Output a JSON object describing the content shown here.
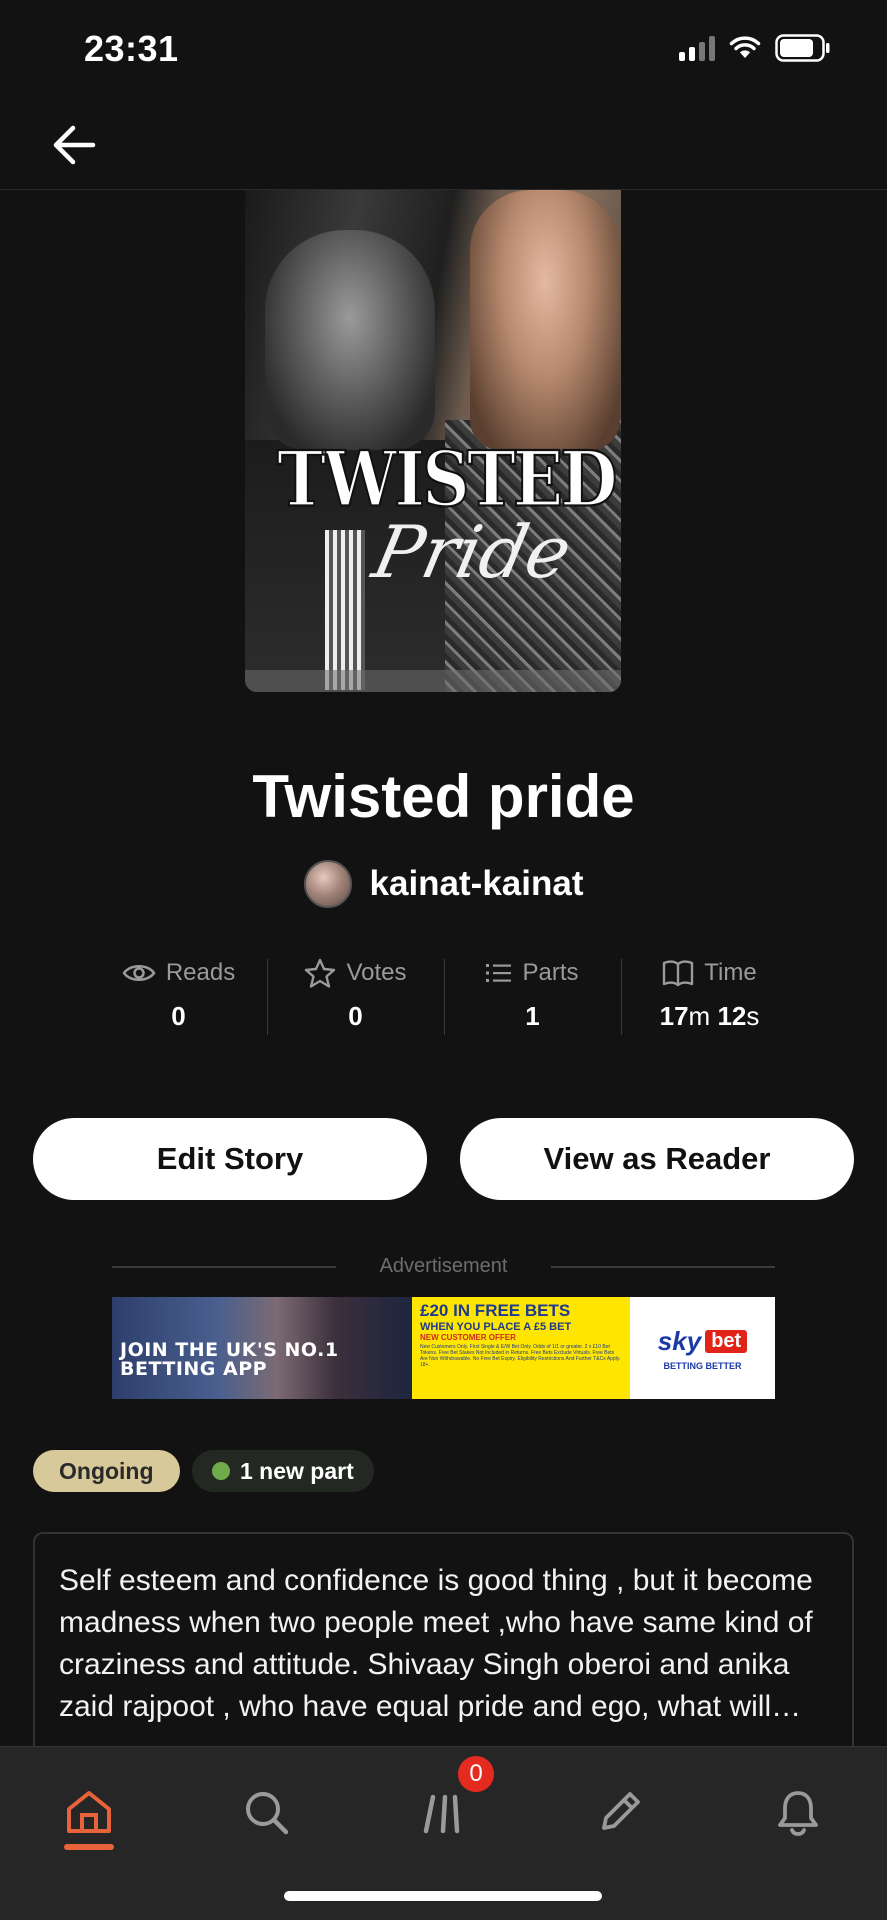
{
  "status_bar": {
    "time": "23:31"
  },
  "story": {
    "title": "Twisted pride",
    "author": "kainat-kainat",
    "cover_text_line1": "TWISTED",
    "cover_text_line2": "Pride"
  },
  "stats": [
    {
      "label": "Reads",
      "value": "0",
      "icon": "eye-icon"
    },
    {
      "label": "Votes",
      "value": "0",
      "icon": "star-icon"
    },
    {
      "label": "Parts",
      "value": "1",
      "icon": "list-icon"
    },
    {
      "label": "Time",
      "value_minutes": "17",
      "unit_minutes": "m",
      "value_seconds": "12",
      "unit_seconds": "s",
      "icon": "book-icon"
    }
  ],
  "buttons": {
    "edit": "Edit Story",
    "reader": "View as Reader"
  },
  "ad": {
    "label": "Advertisement",
    "photo_text": "JOIN THE UK'S NO.1 BETTING APP",
    "offer_headline": "£20 IN FREE BETS",
    "offer_sub": "WHEN YOU PLACE A £5 BET",
    "offer_note": "NEW CUSTOMER OFFER",
    "fine_print": "New Customers Only. First Single & E/W Bet Only. Odds of 1/1 or greater. 2 x £10 Bet Tokens. Free Bet Stakes Not Included in Returns. Free Bets Exclude Virtuals. Free Bets Are Non Withdrawable. No Free Bet Expiry. Eligibility Restrictions And Further T&Cs Apply. 18+.",
    "brand_sky": "sky",
    "brand_bet": "bet",
    "tagline": "BETTING BETTER"
  },
  "tags": {
    "status": "Ongoing",
    "new_parts": "1 new part"
  },
  "description": "Self esteem and confidence is good thing , but it become madness when two people meet ,who have same kind of craziness and attitude.  Shivaay Singh oberoi and anika zaid rajpoot , who have equal pride and ego, what will happen when they meet?",
  "nav": {
    "items": [
      "home-icon",
      "search-icon",
      "library-icon",
      "write-icon",
      "bell-icon"
    ],
    "active": "home",
    "library_badge": "0"
  },
  "colors": {
    "background": "#121212",
    "accent": "#e8623a",
    "badge": "#e52b1f",
    "ongoing": "#d8c99a",
    "new_dot": "#6fab4a"
  }
}
